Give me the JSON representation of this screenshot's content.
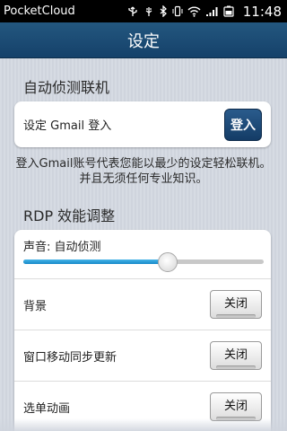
{
  "status_bar": {
    "app_name": "PocketCloud",
    "time": "11:48",
    "icons": [
      "usb-icon",
      "usb-debug-icon",
      "bluetooth-icon",
      "vibrate-icon",
      "wifi-icon",
      "signal-icon",
      "battery-icon"
    ]
  },
  "header": {
    "title": "设定"
  },
  "auto_connect": {
    "section_title": "自动侦测联机",
    "gmail_label": "设定 Gmail 登入",
    "login_button": "登入",
    "info_line1": "登入Gmail账号代表您能以最少的设定轻松联机。",
    "info_line2": "并且无须任何专业知识。"
  },
  "rdp": {
    "section_title": "RDP 效能调整",
    "sound_label": "声音: 自动侦测",
    "sound_slider_fraction": 0.6,
    "rows": [
      {
        "label": "背景",
        "toggle": "关闭"
      },
      {
        "label": "窗口移动同步更新",
        "toggle": "关闭"
      },
      {
        "label": "选单动画",
        "toggle": "关闭"
      }
    ]
  },
  "colors": {
    "header_bg": "#1b4a75",
    "accent_blue": "#1a8ccc",
    "login_button_bg": "#1b4a78"
  }
}
